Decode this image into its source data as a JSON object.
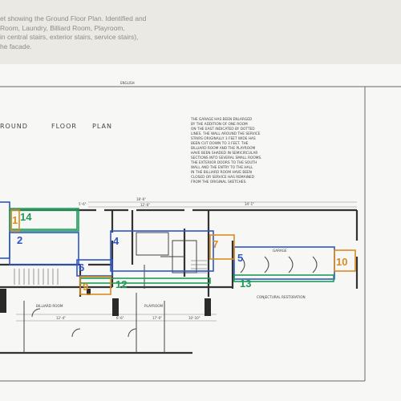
{
  "caption": {
    "lines": [
      "et showing the Ground Floor Plan. Identified and",
      "Room, Laundry, Billiard Room, Playroom,",
      "in central stairs, exterior stairs, service stairs),",
      "he facade."
    ]
  },
  "sheet": {
    "title_part1": "ROUND",
    "title_part2": "FLOOR",
    "title_part3": "PLAN",
    "top_label": "ENGLISH",
    "note_lines": [
      "THE GARAGE HAS BEEN ENLARGED",
      "BY THE ADDITION OF ONE ROOM",
      "ON THE EAST INDICATED BY DOTTED",
      "LINES. THE WALL AROUND THE SERVICE",
      "STAIRS ORIGINALLY 3 FEET WIDE HAS",
      "BEEN CUT DOWN TO 3 FEET. THE",
      "BILLIARD ROOM AND THE PLAYROOM",
      "HAVE BEEN SHADED IN SEMICIRCULAR",
      "SECTIONS INTO SEVERAL SMALL ROOMS.",
      "THE EXTERIOR DOORS TO THE SOUTH",
      "WALL AND THE ENTRY TO THE HALL",
      "IN THE BILLIARD ROOM HAVE BEEN",
      "CLOSED OR SERVICE HAS REMAINED",
      "FROM THE ORIGINAL SKETCHES."
    ],
    "room_labels": {
      "billiard": "BILLIARD ROOM",
      "playroom": "PLAYROOM",
      "garage": "GARAGE",
      "restoration": "CONJECTURAL RESTORATION"
    },
    "dims": {
      "d1": "18'-6\"",
      "d2": "12'-6\"",
      "d3": "34'-1\"",
      "d4": "5'-6\"",
      "d5": "6'-6\"",
      "d6": "12'-4\"",
      "d7": "17'-0\"",
      "d8": "10'-10\""
    }
  },
  "markers": [
    {
      "id": "1",
      "color": "#d98c1f"
    },
    {
      "id": "2",
      "color": "#2f55c4"
    },
    {
      "id": "4",
      "color": "#2f55c4"
    },
    {
      "id": "5",
      "color": "#2f55c4"
    },
    {
      "id": "6",
      "color": "#2f55c4"
    },
    {
      "id": "7",
      "color": "#d98c1f"
    },
    {
      "id": "9",
      "color": "#d98c1f"
    },
    {
      "id": "10",
      "color": "#d98c1f"
    },
    {
      "id": "12",
      "color": "#1f9c5a"
    },
    {
      "id": "13",
      "color": "#1f9c5a"
    },
    {
      "id": "14",
      "color": "#1f9c5a"
    }
  ]
}
